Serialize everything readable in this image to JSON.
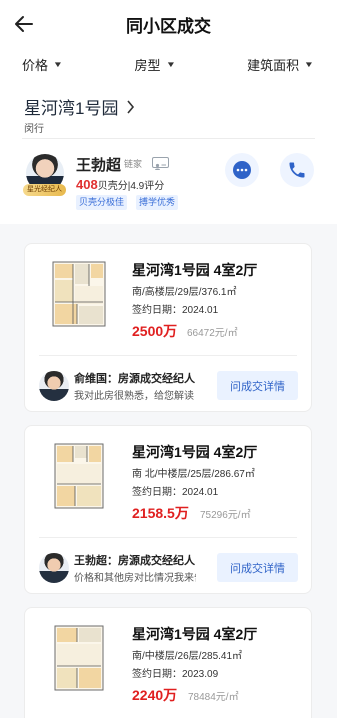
{
  "topbar": {
    "title": "同小区成交"
  },
  "filters": [
    {
      "label": "价格"
    },
    {
      "label": "房型"
    },
    {
      "label": "建筑面积"
    }
  ],
  "community": {
    "name": "星河湾1号园",
    "district": "闵行"
  },
  "agent": {
    "badge": "星光经纪人",
    "name": "王勃超",
    "brand": "链家",
    "score": "408",
    "score_label": "贝壳分",
    "rating": "4.9评分",
    "tags": [
      "贝壳分极佳",
      "搏学优秀"
    ]
  },
  "listings": [
    {
      "title": "星河湾1号园 4室2厅",
      "meta": "南/高楼层/29层/376.1㎡",
      "date": "签约日期：2024.01",
      "price": "2500万",
      "unit_price": "66472元/㎡",
      "reviewer": "俞维国：房源成交经纪人",
      "review": "我对此房很熟悉，给您解读",
      "ask": "问成交详情"
    },
    {
      "title": "星河湾1号园 4室2厅",
      "meta": "南 北/中楼层/25层/286.67㎡",
      "date": "签约日期：2024.01",
      "price": "2158.5万",
      "unit_price": "75296元/㎡",
      "reviewer": "王勃超：房源成交经纪人",
      "review": "价格和其他房对比情况我来告诉您",
      "ask": "问成交详情"
    },
    {
      "title": "星河湾1号园 4室2厅",
      "meta": "南/中楼层/26层/285.41㎡",
      "date": "签约日期：2023.09",
      "price": "2240万",
      "unit_price": "78484元/㎡"
    }
  ],
  "colors": {
    "price": "#e02020",
    "accent": "#2f63c8",
    "tag_bg": "#e9f1ff"
  }
}
